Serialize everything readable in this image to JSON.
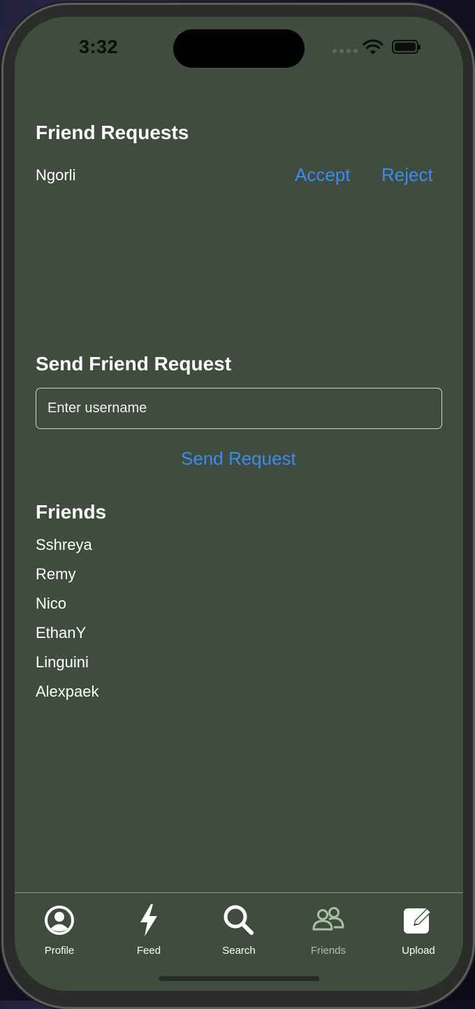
{
  "status_bar": {
    "time": "3:32"
  },
  "friend_requests": {
    "title": "Friend Requests",
    "items": [
      {
        "name": "Ngorli",
        "accept_label": "Accept",
        "reject_label": "Reject"
      }
    ]
  },
  "send_request": {
    "title": "Send Friend Request",
    "input_placeholder": "Enter username",
    "input_value": "",
    "button_label": "Send Request"
  },
  "friends": {
    "title": "Friends",
    "names": [
      "Sshreya",
      "Remy",
      "Nico",
      "EthanY",
      "Linguini",
      "Alexpaek"
    ]
  },
  "tab_bar": {
    "tabs": [
      {
        "label": "Profile",
        "icon": "person-circle-icon"
      },
      {
        "label": "Feed",
        "icon": "bolt-icon"
      },
      {
        "label": "Search",
        "icon": "magnifying-glass-icon"
      },
      {
        "label": "Friends",
        "icon": "people-icon",
        "active": true
      },
      {
        "label": "Upload",
        "icon": "square-pencil-icon"
      }
    ]
  },
  "colors": {
    "background": "#3f4c3e",
    "link": "#3b8bf0",
    "active_tab": "#a7c3a2",
    "text": "#ffffff"
  }
}
